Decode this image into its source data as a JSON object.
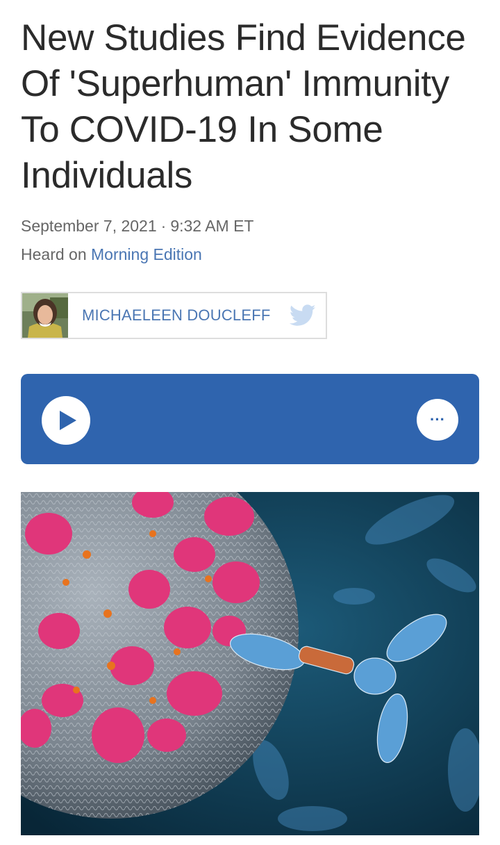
{
  "article": {
    "headline": "New Studies Find Evidence Of 'Superhuman' Immunity To COVID-19 In Some Individuals",
    "date": "September 7, 2021",
    "separator": "·",
    "time": "9:32 AM ET",
    "heard_prefix": "Heard on",
    "program": "Morning Edition"
  },
  "byline": {
    "author": "MICHAELEEN DOUCLEFF",
    "avatar_icon": "author-photo",
    "social_icon": "twitter-icon"
  },
  "player": {
    "play_icon": "play-icon",
    "more_label": "···",
    "background": "#2f64ae"
  },
  "hero_image": {
    "icon": "coronavirus-antibody-illustration"
  },
  "colors": {
    "link": "#4a76b3",
    "virus_spike": "#e0367a",
    "background_dark": "#0e3a55"
  }
}
